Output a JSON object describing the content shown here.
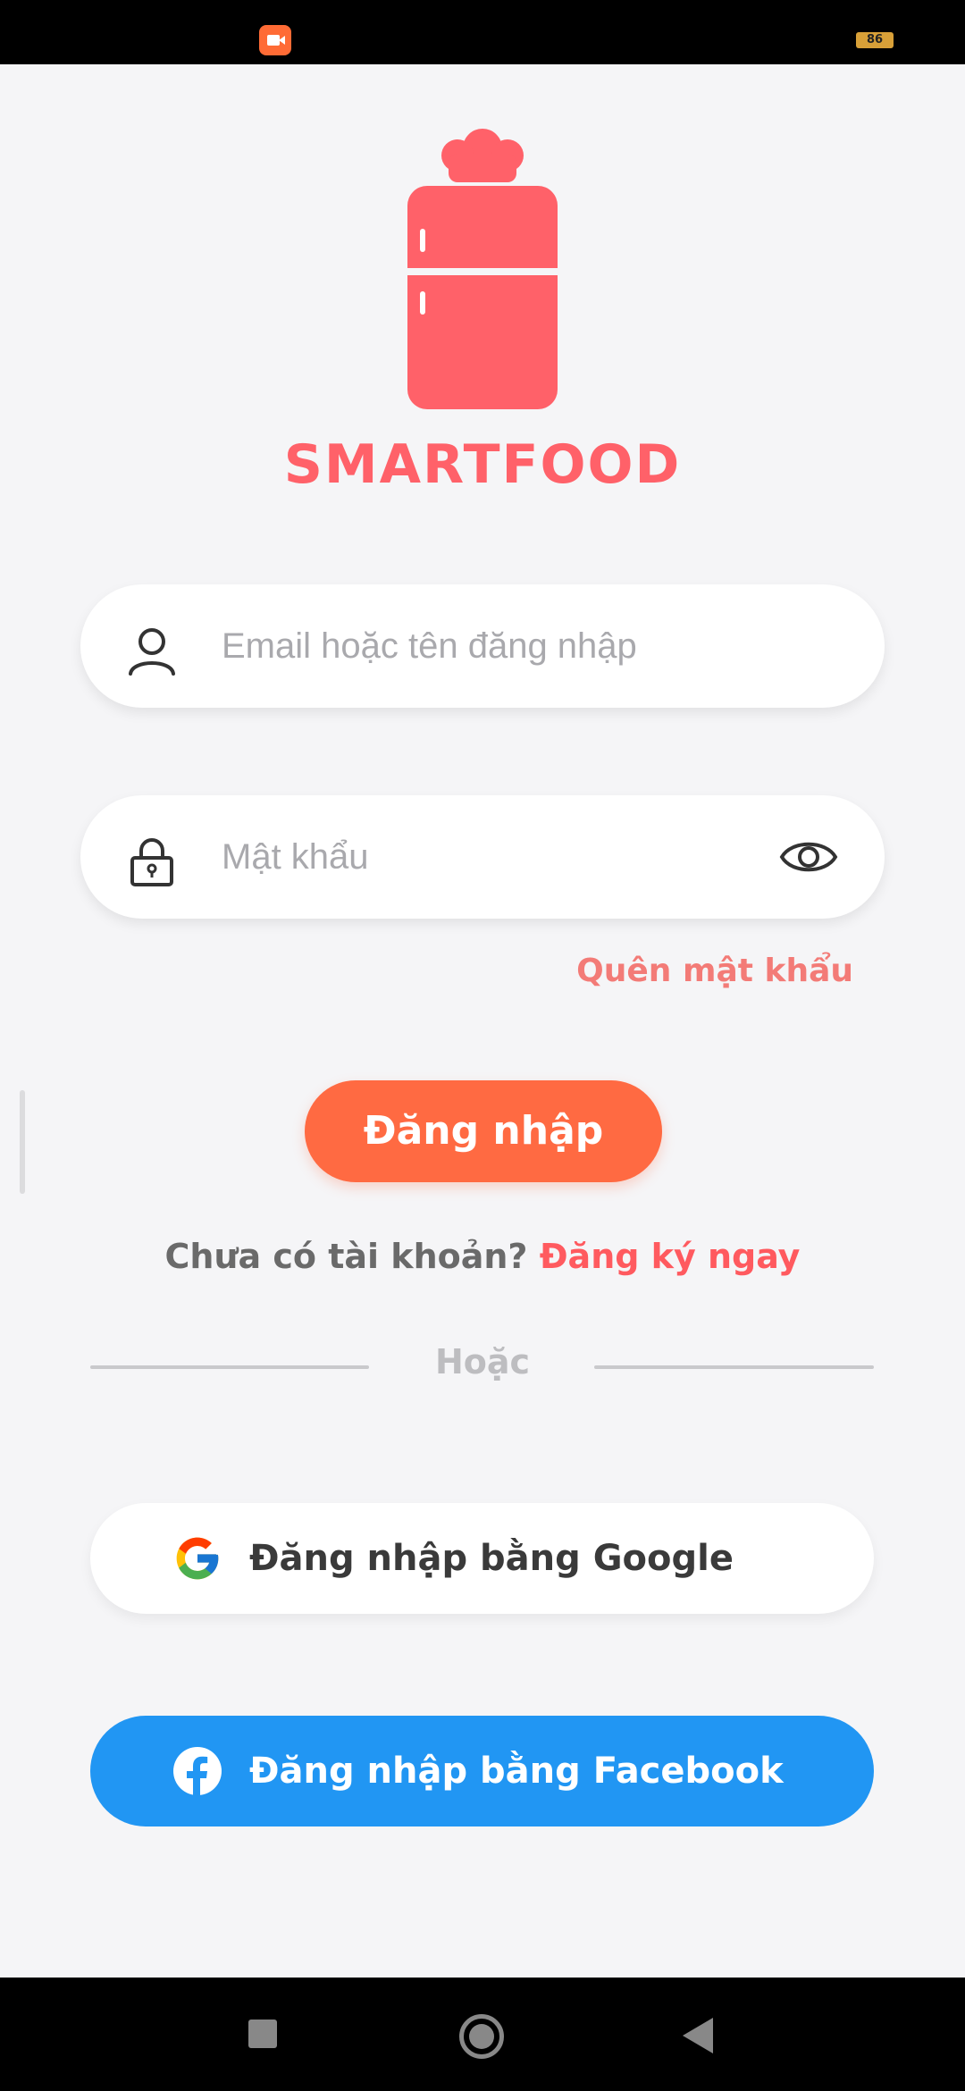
{
  "status_bar": {
    "battery_level": "86"
  },
  "app": {
    "name": "SMARTFOOD",
    "brand_color": "#ff6169"
  },
  "login_form": {
    "email_placeholder": "Email hoặc tên đăng nhập",
    "password_placeholder": "Mật khẩu",
    "forgot_password_label": "Quên mật khẩu",
    "login_button_label": "Đăng nhập",
    "no_account_text": "Chưa có tài khoản?",
    "register_link_label": "Đăng ký ngay"
  },
  "divider": {
    "label": "Hoặc"
  },
  "social_login": {
    "google_label": "Đăng nhập bằng Google",
    "facebook_label": "Đăng nhập bằng Facebook",
    "facebook_color": "#2196f3"
  },
  "icons": {
    "email_field": "user-icon",
    "password_field": "lock-icon",
    "password_toggle": "eye-icon",
    "google": "google-icon",
    "facebook": "facebook-icon"
  },
  "colors": {
    "accent": "#ff6a42",
    "link": "#ff5a5f",
    "background": "#f5f5f7"
  }
}
